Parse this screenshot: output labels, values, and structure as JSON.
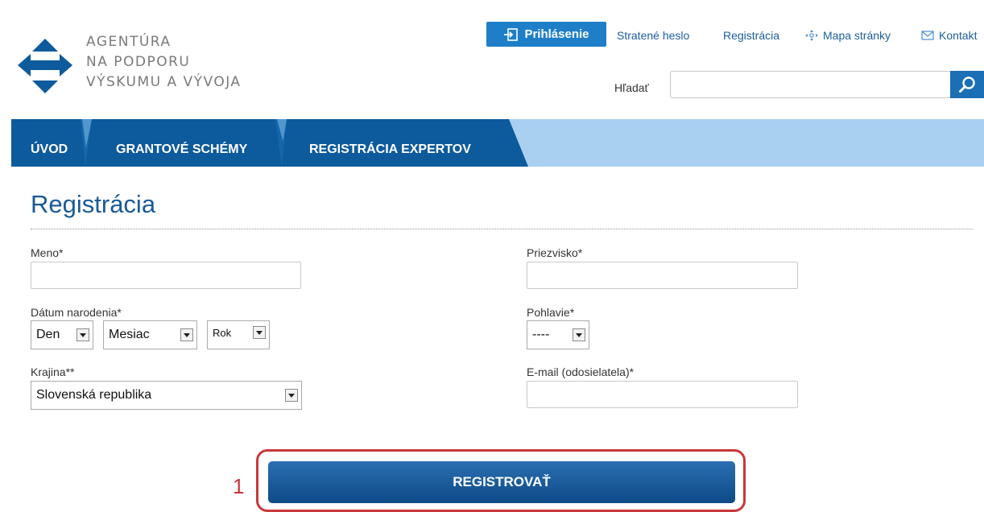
{
  "logo": {
    "line1": "AGENTÚRA",
    "line2": "NA PODPORU",
    "line3": "VÝSKUMU A VÝVOJA",
    "icon": "apvv-diamond-logo"
  },
  "top_links": {
    "login": "Prihlásenie",
    "lost_password": "Stratené heslo",
    "register": "Registrácia",
    "sitemap": "Mapa stránky",
    "contact": "Kontakt"
  },
  "search": {
    "label": "Hľadať",
    "value": ""
  },
  "nav": {
    "items": [
      "ÚVOD",
      "GRANTOVÉ SCHÉMY",
      "REGISTRÁCIA EXPERTOV"
    ]
  },
  "page": {
    "title": "Registrácia"
  },
  "form": {
    "first_name": {
      "label": "Meno*",
      "value": ""
    },
    "last_name": {
      "label": "Priezvisko*",
      "value": ""
    },
    "birth": {
      "label": "Dátum narodenia*",
      "day": "Den",
      "month": "Mesiac",
      "year": "Rok"
    },
    "gender": {
      "label": "Pohlavie*",
      "value": "----"
    },
    "country": {
      "label": "Krajina**",
      "value": "Slovenská republika"
    },
    "email": {
      "label": "E-mail (odosielatela)*",
      "value": ""
    }
  },
  "register_button": "REGISTROVAŤ",
  "annotation_number": "1",
  "colors": {
    "primary": "#1e7fc8",
    "nav_dark": "#0d5a9c",
    "nav_light": "#a9d0f1",
    "title": "#1a5a96",
    "highlight": "#c9383a"
  }
}
